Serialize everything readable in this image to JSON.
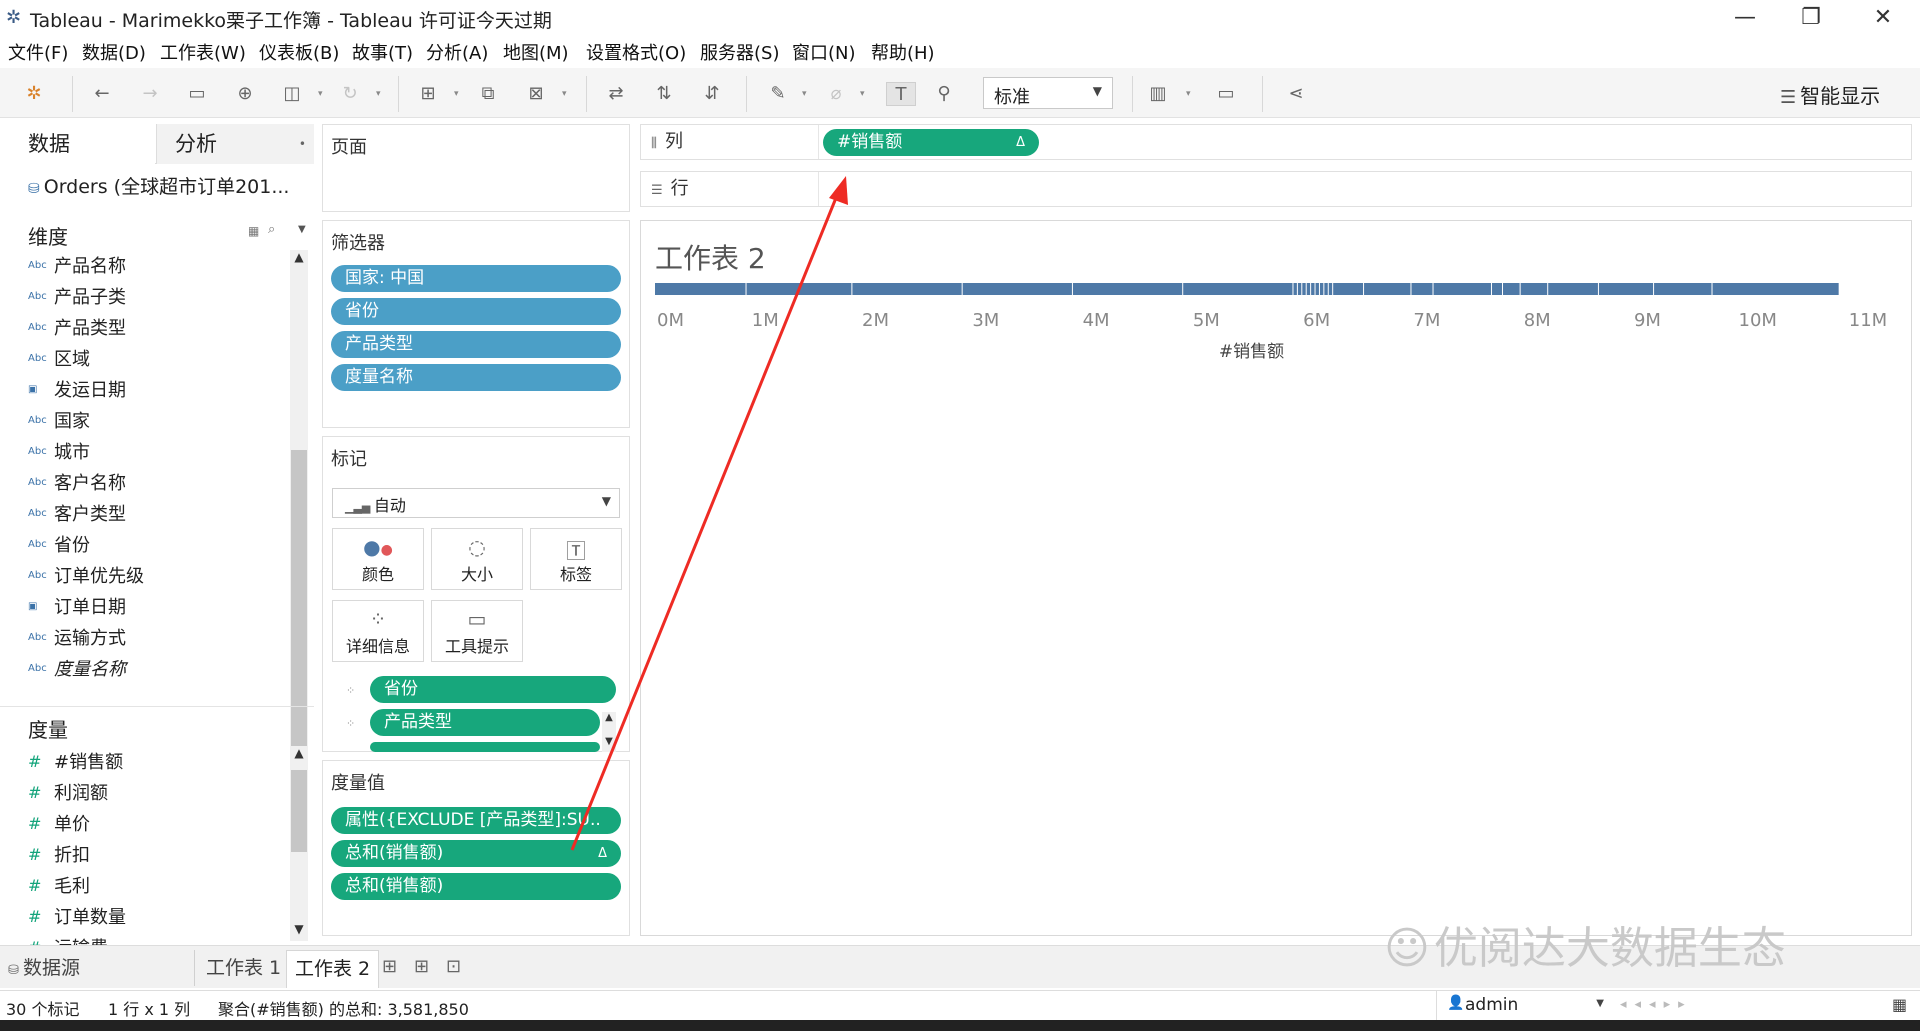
{
  "window": {
    "title": "Tableau - Marimekko栗子工作簿 - Tableau 许可证今天过期",
    "minimize": "—",
    "restore": "❐",
    "close": "✕"
  },
  "menus": [
    "文件(F)",
    "数据(D)",
    "工作表(W)",
    "仪表板(B)",
    "故事(T)",
    "分析(A)",
    "地图(M)",
    "设置格式(O)",
    "服务器(S)",
    "窗口(N)",
    "帮助(H)"
  ],
  "toolbar": {
    "fit_value": "标准",
    "show_me_label": "智能显示",
    "icons": [
      "tableau-logo-icon",
      "back-icon",
      "forward-icon",
      "save-icon",
      "new-datasource-icon",
      "pause-icon",
      "refresh-icon",
      "new-worksheet-icon",
      "duplicate-icon",
      "clear-icon",
      "swap-icon",
      "sort-ascending-icon",
      "sort-descending-icon",
      "highlight-icon",
      "group-icon",
      "label-icon",
      "pin-icon",
      "chart-size-icon",
      "presentation-icon",
      "share-icon"
    ]
  },
  "left_pane": {
    "tab_data": "数据",
    "tab_analysis": "分析",
    "datasource": "Orders (全球超市订单201...",
    "dimensions_header": "维度",
    "dimensions": [
      {
        "type": "Abc",
        "name": "产品名称"
      },
      {
        "type": "Abc",
        "name": "产品子类"
      },
      {
        "type": "Abc",
        "name": "产品类型"
      },
      {
        "type": "Abc",
        "name": "区域"
      },
      {
        "type": "date",
        "name": "发运日期"
      },
      {
        "type": "Abc",
        "name": "国家"
      },
      {
        "type": "Abc",
        "name": "城市"
      },
      {
        "type": "Abc",
        "name": "客户名称"
      },
      {
        "type": "Abc",
        "name": "客户类型"
      },
      {
        "type": "Abc",
        "name": "省份"
      },
      {
        "type": "Abc",
        "name": "订单优先级"
      },
      {
        "type": "date",
        "name": "订单日期"
      },
      {
        "type": "Abc",
        "name": "运输方式"
      },
      {
        "type": "Abc",
        "name": "度量名称"
      }
    ],
    "measures_header": "度量",
    "measures": [
      {
        "type": "#",
        "name": "#销售额"
      },
      {
        "type": "#",
        "name": "利润额"
      },
      {
        "type": "#",
        "name": "单价"
      },
      {
        "type": "#",
        "name": "折扣"
      },
      {
        "type": "#",
        "name": "毛利"
      },
      {
        "type": "#",
        "name": "订单数量"
      },
      {
        "type": "#",
        "name": "运输费"
      }
    ]
  },
  "pages": {
    "title": "页面"
  },
  "filters": {
    "title": "筛选器",
    "items": [
      "国家: 中国",
      "省份",
      "产品类型",
      "度量名称"
    ]
  },
  "marks": {
    "title": "标记",
    "type": "自动",
    "buttons": [
      {
        "icon": "color-icon",
        "label": "颜色"
      },
      {
        "icon": "size-icon",
        "label": "大小"
      },
      {
        "icon": "label-icon",
        "label": "标签"
      },
      {
        "icon": "detail-icon",
        "label": "详细信息"
      },
      {
        "icon": "tooltip-icon",
        "label": "工具提示"
      }
    ],
    "fields": [
      "省份",
      "产品类型",
      "度量值"
    ]
  },
  "measure_values": {
    "title": "度量值",
    "items": [
      {
        "label": "属性({EXCLUDE [产品类型]:SU..",
        "delta": ""
      },
      {
        "label": "总和(销售额)",
        "delta": "Δ"
      },
      {
        "label": "总和(销售额)",
        "delta": ""
      }
    ]
  },
  "shelves": {
    "columns_label": "列",
    "columns_pill": "#销售额",
    "columns_pill_delta": "Δ",
    "rows_label": "行"
  },
  "view": {
    "title": "工作表 2"
  },
  "chart_data": {
    "type": "bar",
    "orientation": "horizontal",
    "title": "",
    "xlabel": "#销售额",
    "ylabel": "",
    "xlim": [
      0,
      11000000
    ],
    "tick_labels": [
      "0M",
      "1M",
      "2M",
      "3M",
      "4M",
      "5M",
      "6M",
      "7M",
      "8M",
      "9M",
      "10M",
      "11M"
    ],
    "tick_values": [
      0,
      1000000,
      2000000,
      3000000,
      4000000,
      5000000,
      6000000,
      7000000,
      8000000,
      9000000,
      10000000,
      11000000
    ],
    "stacked_total": 10743000,
    "segment_boundaries": [
      0,
      830000,
      1790000,
      2790000,
      3790000,
      4790000,
      5790000,
      5830000,
      5870000,
      5910000,
      5950000,
      5990000,
      6030000,
      6070000,
      6110000,
      6150000,
      6430000,
      6860000,
      7060000,
      7590000,
      7690000,
      7850000,
      8100000,
      8560000,
      9060000,
      9590000,
      10743000
    ],
    "color": "#4e79a7",
    "grid": false
  },
  "sheets": {
    "datasource_tab": "数据源",
    "tabs": [
      "工作表 1",
      "工作表 2"
    ],
    "active": "工作表 2"
  },
  "status": {
    "marks": "30 个标记",
    "rows_cols": "1 行 x 1 列",
    "aggregate": "聚合(#销售额) 的总和: 3,581,850",
    "user": "admin"
  },
  "watermark": "优阅达大数据生态",
  "colors": {
    "dimension_pill": "#4b9fc7",
    "measure_pill": "#17a77c",
    "bar": "#4e79a7",
    "annotation_arrow": "#ee2b24"
  }
}
